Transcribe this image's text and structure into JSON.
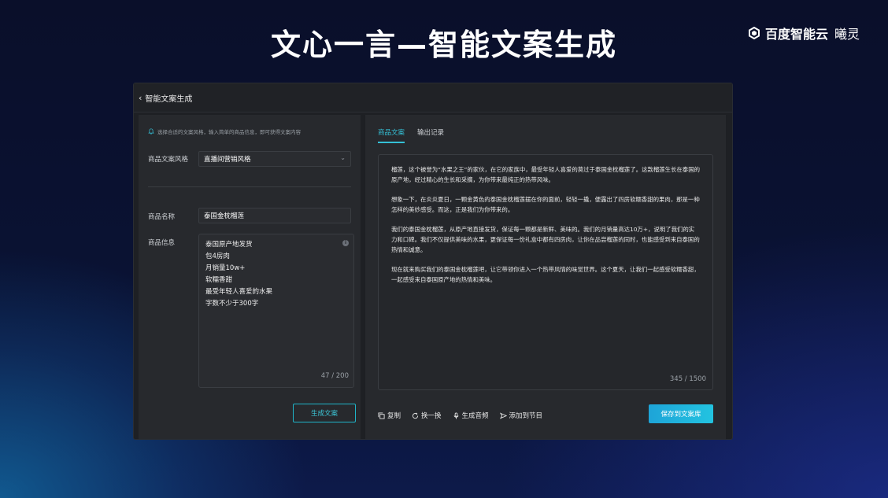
{
  "slide": {
    "title": "文心一言—智能文案生成",
    "brand_name": "百度智能云",
    "brand_sub": "曦灵"
  },
  "header": {
    "back_icon": "chevron-left-icon",
    "title": "智能文案生成"
  },
  "left": {
    "tip": "选择合适的文案风格，输入简单的商品信息，即可获得文案内容",
    "style_label": "商品文案风格",
    "style_value": "直播间营销风格",
    "name_label": "商品名称",
    "name_value": "泰国金枕榴莲",
    "info_label": "商品信息",
    "info_lines": [
      "泰国原产地发货",
      "包4房肉",
      "月销量10w+",
      "软糯香甜",
      "最受年轻人喜爱的水果",
      "字数不少于300字"
    ],
    "info_counter": "47 / 200",
    "generate_label": "生成文案"
  },
  "right": {
    "tabs": [
      {
        "label": "商品文案",
        "active": true
      },
      {
        "label": "输出记录",
        "active": false
      }
    ],
    "paragraphs": [
      "榴莲，这个被誉为“水果之王”的家伙，在它的家族中，最受年轻人喜爱的莫过于泰国金枕榴莲了。这款榴莲生长在泰国的原产地，经过精心的生长和采摘，为你带来最纯正的热带风味。",
      "想象一下，在炎炎夏日，一颗金黄色的泰国金枕榴莲摆在你的面前，轻轻一撬，便露出了四房软糯香甜的果肉，那是一种怎样的美妙感受。而这，正是我们为你带来的。",
      "我们的泰国金枕榴莲，从原产地直接发货，保证每一颗都是新鲜、美味的。我们的月销量高达10万+，说明了我们的实力和口碑。我们不仅提供美味的水果，更保证每一份礼盒中都有四房肉，让你在品尝榴莲的同时，也能感受到来自泰国的热情和诚意。",
      "现在就来购买我们的泰国金枕榴莲吧，让它带领你进入一个热带风情的味觉世界。这个夏天，让我们一起感受软糯香甜，一起感受来自泰国原产地的热情和美味。"
    ],
    "output_counter": "345 / 1500",
    "actions": {
      "copy": "复制",
      "swap": "换一换",
      "audio": "生成音频",
      "add_program": "添加到节目"
    },
    "save_label": "保存到文案库"
  },
  "colors": {
    "accent": "#34c0d6",
    "save_button": "#1ea4d8"
  }
}
